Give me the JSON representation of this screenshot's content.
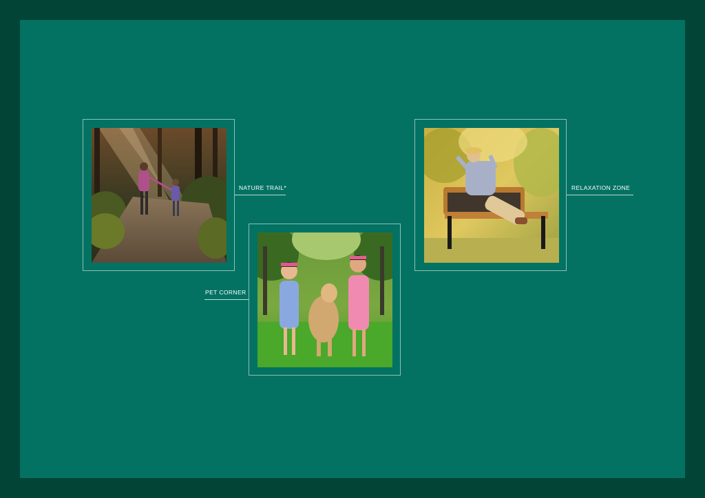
{
  "features": [
    {
      "id": "nature",
      "label": "NATURE TRAIL*",
      "image": "mother-and-child-walking-forest-trail-photo"
    },
    {
      "id": "relax",
      "label": "RELAXATION ZONE",
      "image": "elderly-man-relaxing-on-park-bench-photo"
    },
    {
      "id": "pet",
      "label": "PET CORNER",
      "image": "girls-running-with-dog-in-park-photo"
    }
  ],
  "colors": {
    "outer": "#024537",
    "panel": "#037262",
    "frame": "#bedcd4",
    "label": "#ffffff"
  }
}
